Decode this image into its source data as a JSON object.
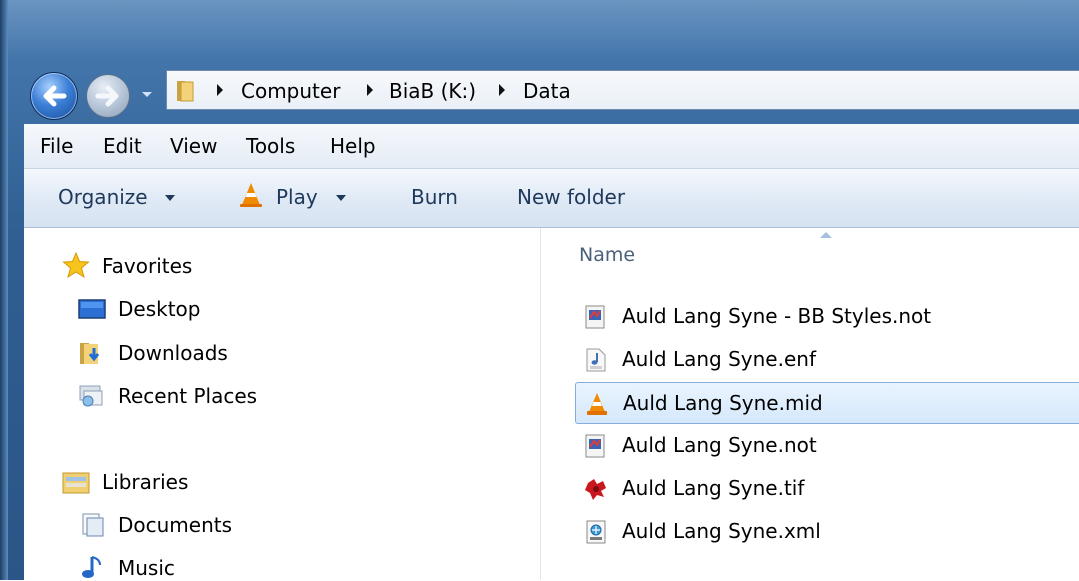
{
  "breadcrumb": {
    "items": [
      "Computer",
      "BiaB (K:)",
      "Data"
    ]
  },
  "menu": {
    "items": [
      "File",
      "Edit",
      "View",
      "Tools",
      "Help"
    ]
  },
  "commands": {
    "organize": "Organize",
    "play": "Play",
    "burn": "Burn",
    "new_folder": "New folder"
  },
  "nav": {
    "favorites": "Favorites",
    "desktop": "Desktop",
    "downloads": "Downloads",
    "recent_places": "Recent Places",
    "libraries": "Libraries",
    "documents": "Documents",
    "music": "Music"
  },
  "files": {
    "column_name": "Name",
    "items": [
      {
        "name": "Auld Lang Syne - BB Styles.not",
        "icon": "notation-file-icon"
      },
      {
        "name": "Auld Lang Syne.enf",
        "icon": "music-note-file-icon"
      },
      {
        "name": "Auld Lang Syne.mid",
        "icon": "vlc-cone-icon",
        "selected": true
      },
      {
        "name": "Auld Lang Syne.not",
        "icon": "notation-file-icon"
      },
      {
        "name": "Auld Lang Syne.tif",
        "icon": "red-image-icon"
      },
      {
        "name": "Auld Lang Syne.xml",
        "icon": "xml-file-icon"
      }
    ]
  },
  "colors": {
    "frame": "#2f5f93",
    "selection": "#d5e8fc",
    "selection_border": "#84acdd",
    "command_text": "#1e395b"
  }
}
